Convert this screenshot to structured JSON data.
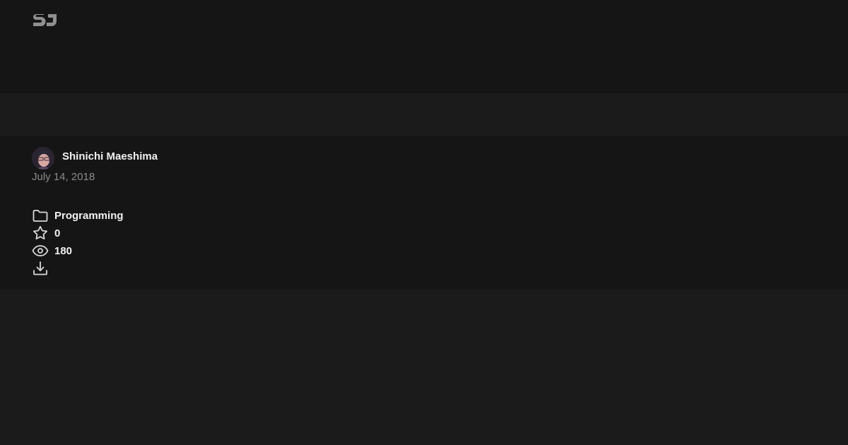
{
  "header": {
    "logo_icon": "sj-logo-icon"
  },
  "author": {
    "name": "Shinichi Maeshima",
    "avatar_icon": "user-avatar"
  },
  "post": {
    "date": "July 14, 2018"
  },
  "stats": {
    "category": {
      "icon": "folder-icon",
      "label": "Programming"
    },
    "stars": {
      "icon": "star-icon",
      "value": "0"
    },
    "views": {
      "icon": "eye-icon",
      "value": "180"
    },
    "download": {
      "icon": "download-icon"
    }
  },
  "colors": {
    "background": "#1b1b1b",
    "band": "#151515",
    "text": "#f2f2f2",
    "muted": "#8a8a8a",
    "icon": "#d9d9d9"
  }
}
